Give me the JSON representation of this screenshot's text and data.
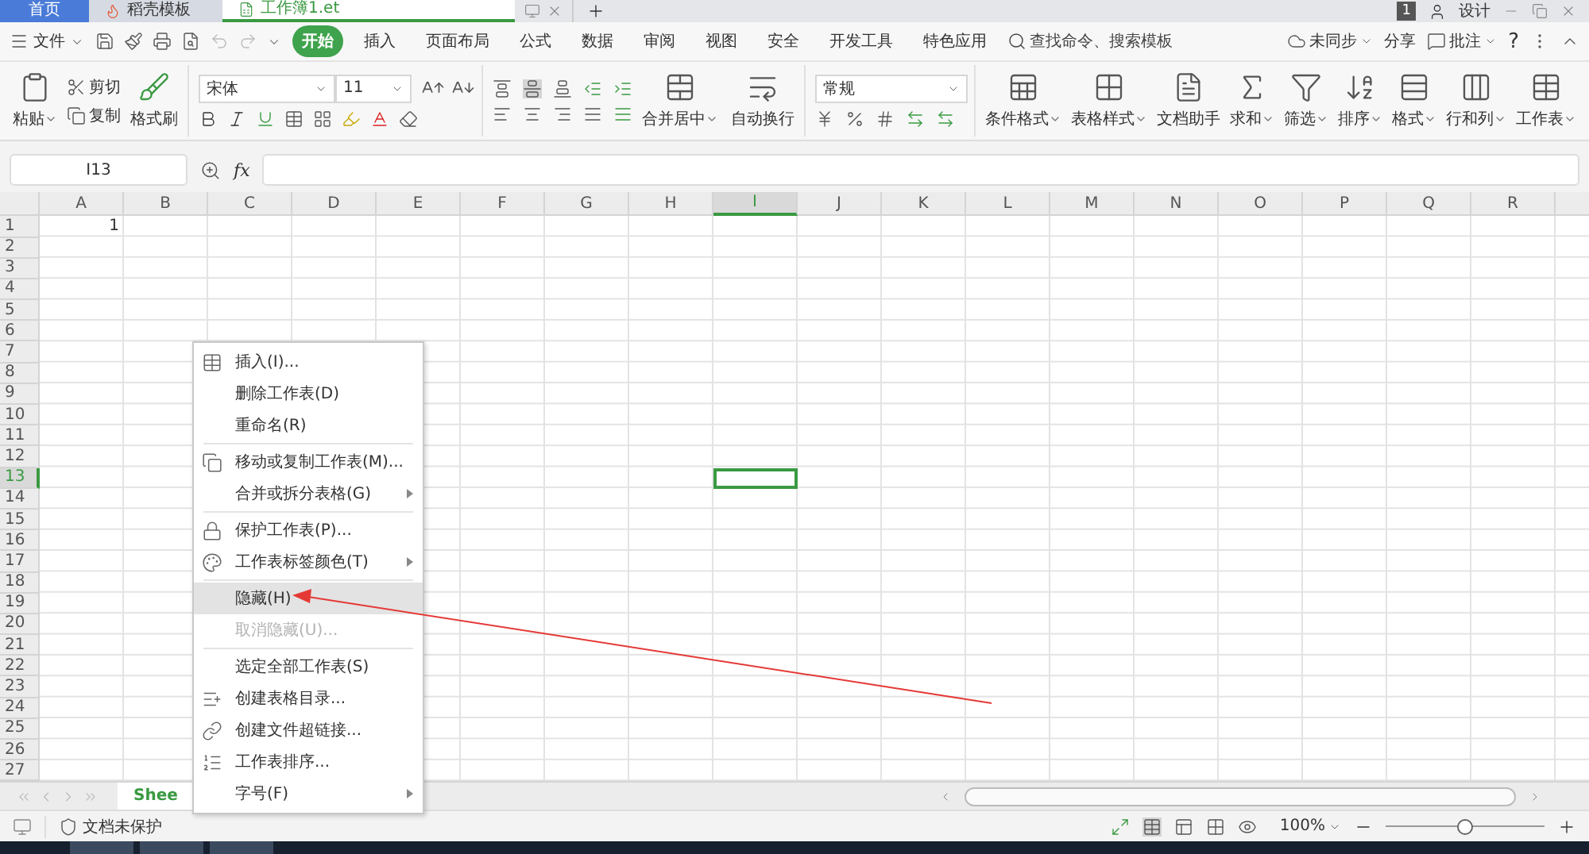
{
  "tab_bar": {
    "tabs": [
      {
        "label": "首页",
        "kind": "home",
        "selected": false
      },
      {
        "label": "稻壳模板",
        "kind": "docer",
        "selected": false
      },
      {
        "label": "工作簿1.et",
        "kind": "sheet",
        "selected": true
      }
    ],
    "badge": "1",
    "user_menu": "设计"
  },
  "menu_bar": {
    "file": "文件",
    "tabs": [
      {
        "label": "开始",
        "selected": true
      },
      {
        "label": "插入",
        "selected": false
      },
      {
        "label": "页面布局",
        "selected": false
      },
      {
        "label": "公式",
        "selected": false
      },
      {
        "label": "数据",
        "selected": false
      },
      {
        "label": "审阅",
        "selected": false
      },
      {
        "label": "视图",
        "selected": false
      },
      {
        "label": "安全",
        "selected": false
      },
      {
        "label": "开发工具",
        "selected": false
      },
      {
        "label": "特色应用",
        "selected": false
      }
    ],
    "search": {
      "placeholder": "查找命令、搜索模板"
    },
    "sync": "未同步",
    "share": "分享",
    "comment": "批注",
    "help": "?"
  },
  "ribbon": {
    "clipboard": [
      {
        "label": "粘贴",
        "dropdown": true
      },
      {
        "label": "剪切",
        "dropdown": false
      },
      {
        "label": "复制",
        "dropdown": false
      },
      {
        "label": "格式刷",
        "dropdown": false
      }
    ],
    "font": {
      "name": "宋体",
      "size": "11"
    },
    "align_buttons": [
      {
        "label": "合并居中",
        "kind": "merge",
        "dropdown": true
      },
      {
        "label": "自动换行",
        "kind": "wrap",
        "dropdown": false
      }
    ],
    "number_format": "常规",
    "tools": [
      {
        "label": "条件格式",
        "kind": "conditional",
        "dropdown": true
      },
      {
        "label": "表格样式",
        "kind": "table_style",
        "dropdown": true
      },
      {
        "label": "文档助手",
        "kind": "assistant",
        "dropdown": false
      },
      {
        "label": "求和",
        "kind": "sum",
        "dropdown": true
      },
      {
        "label": "筛选",
        "kind": "filter",
        "dropdown": true
      },
      {
        "label": "排序",
        "kind": "sort",
        "dropdown": true
      },
      {
        "label": "格式",
        "kind": "format",
        "dropdown": true
      },
      {
        "label": "行和列",
        "kind": "rowcol",
        "dropdown": true
      },
      {
        "label": "工作表",
        "kind": "sheet",
        "dropdown": true
      }
    ]
  },
  "formula_bar": {
    "name_box": "I13",
    "function_label": "fx"
  },
  "sheet": {
    "columns": [
      {
        "label": "A",
        "selected": false
      },
      {
        "label": "B",
        "selected": false
      },
      {
        "label": "C",
        "selected": false
      },
      {
        "label": "D",
        "selected": false
      },
      {
        "label": "E",
        "selected": false
      },
      {
        "label": "F",
        "selected": false
      },
      {
        "label": "G",
        "selected": false
      },
      {
        "label": "H",
        "selected": false
      },
      {
        "label": "I",
        "selected": true
      },
      {
        "label": "J",
        "selected": false
      },
      {
        "label": "K",
        "selected": false
      },
      {
        "label": "L",
        "selected": false
      },
      {
        "label": "M",
        "selected": false
      },
      {
        "label": "N",
        "selected": false
      },
      {
        "label": "O",
        "selected": false
      },
      {
        "label": "P",
        "selected": false
      },
      {
        "label": "Q",
        "selected": false
      },
      {
        "label": "R",
        "selected": false
      }
    ],
    "rows": [
      {
        "label": "1",
        "selected": false,
        "cells": [
          "1"
        ]
      },
      {
        "label": "2",
        "selected": false
      },
      {
        "label": "3",
        "selected": false
      },
      {
        "label": "4",
        "selected": false
      },
      {
        "label": "5",
        "selected": false
      },
      {
        "label": "6",
        "selected": false
      },
      {
        "label": "7",
        "selected": false
      },
      {
        "label": "8",
        "selected": false
      },
      {
        "label": "9",
        "selected": false
      },
      {
        "label": "10",
        "selected": false
      },
      {
        "label": "11",
        "selected": false
      },
      {
        "label": "12",
        "selected": false
      },
      {
        "label": "13",
        "selected": true
      },
      {
        "label": "14",
        "selected": false
      },
      {
        "label": "15",
        "selected": false
      },
      {
        "label": "16",
        "selected": false
      },
      {
        "label": "17",
        "selected": false
      },
      {
        "label": "18",
        "selected": false
      },
      {
        "label": "19",
        "selected": false
      },
      {
        "label": "20",
        "selected": false
      },
      {
        "label": "21",
        "selected": false
      },
      {
        "label": "22",
        "selected": false
      },
      {
        "label": "23",
        "selected": false
      },
      {
        "label": "24",
        "selected": false
      },
      {
        "label": "25",
        "selected": false
      },
      {
        "label": "26",
        "selected": false
      },
      {
        "label": "27",
        "selected": false
      }
    ]
  },
  "context_menu": {
    "groups": [
      [
        {
          "label": "插入(I)...",
          "kind": "table",
          "submenu": false,
          "disabled": false,
          "selected": false
        },
        {
          "label": "删除工作表(D)",
          "kind": "plain",
          "submenu": false,
          "disabled": false,
          "selected": false
        },
        {
          "label": "重命名(R)",
          "kind": "plain",
          "submenu": false,
          "disabled": false,
          "selected": false
        }
      ],
      [
        {
          "label": "移动或复制工作表(M)...",
          "kind": "move",
          "submenu": false,
          "disabled": false,
          "selected": false
        },
        {
          "label": "合并或拆分表格(G)",
          "kind": "plain",
          "submenu": true,
          "disabled": false,
          "selected": false
        }
      ],
      [
        {
          "label": "保护工作表(P)...",
          "kind": "protect",
          "submenu": false,
          "disabled": false,
          "selected": false
        },
        {
          "label": "工作表标签颜色(T)",
          "kind": "tabcolor",
          "submenu": true,
          "disabled": false,
          "selected": false
        }
      ],
      [
        {
          "label": "隐藏(H)",
          "kind": "plain",
          "submenu": false,
          "disabled": false,
          "selected": true
        },
        {
          "label": "取消隐藏(U)...",
          "kind": "plain",
          "submenu": false,
          "disabled": true,
          "selected": false
        }
      ],
      [
        {
          "label": "选定全部工作表(S)",
          "kind": "plain",
          "submenu": false,
          "disabled": false,
          "selected": false
        },
        {
          "label": "创建表格目录...",
          "kind": "toc",
          "submenu": false,
          "disabled": false,
          "selected": false
        },
        {
          "label": "创建文件超链接...",
          "kind": "link",
          "submenu": false,
          "disabled": false,
          "selected": false
        },
        {
          "label": "工作表排序...",
          "kind": "sort",
          "submenu": false,
          "disabled": false,
          "selected": false
        },
        {
          "label": "字号(F)",
          "kind": "plain",
          "submenu": true,
          "disabled": false,
          "selected": false
        }
      ]
    ]
  },
  "sheet_tabs": [
    {
      "label": "Shee",
      "selected": true
    }
  ],
  "status_bar": {
    "protection": "文档未保护",
    "zoom": "100%",
    "zoom_slider": {
      "level": 0.5
    }
  }
}
